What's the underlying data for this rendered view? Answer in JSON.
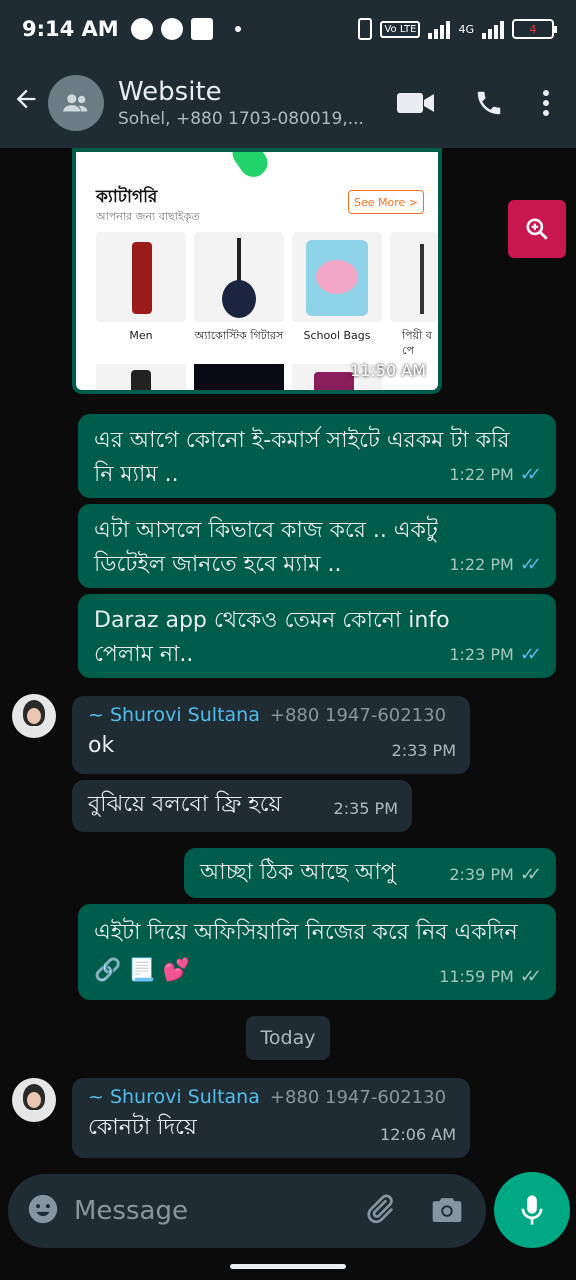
{
  "status_bar": {
    "time": "9:14 AM",
    "vo_lte": "Vo LTE",
    "network": "4G",
    "battery": "4"
  },
  "header": {
    "title": "Website",
    "subtitle": "Sohel, +880 1703-080019,...",
    "icons": [
      "back-arrow-icon",
      "group-avatar-icon",
      "video-call-icon",
      "voice-call-icon",
      "more-options-icon"
    ]
  },
  "image_message": {
    "category_title": "ক্যাটাগরি",
    "category_subtitle": "আপনার জন্য বাছাইকৃত",
    "see_more": "See More >",
    "products": [
      "Men",
      "অ্যাকোস্টিক গিটারস",
      "School Bags",
      "পিয়ী ব পে"
    ],
    "time": "11:50 AM"
  },
  "messages": [
    {
      "dir": "out",
      "text": "এর আগে কোনো ই-কমার্স সাইটে এরকম টা করি নি ম্যাম ..",
      "time": "1:22 PM",
      "read": true
    },
    {
      "dir": "out",
      "text": "এটা আসলে কিভাবে কাজ করে .. একটু ডিটেইল জানতে হবে ম্যাম ..",
      "time": "1:22 PM",
      "read": true
    },
    {
      "dir": "out",
      "text": "Daraz app থেকেও তেমন কোনো info পেলাম না..",
      "time": "1:23 PM",
      "read": true
    },
    {
      "dir": "in",
      "sender": "~ Shurovi Sultana",
      "number": "+880 1947-602130",
      "text": "ok",
      "time": "2:33 PM"
    },
    {
      "dir": "in",
      "text": "বুঝিয়ে বলবো ফ্রি হয়ে",
      "time": "2:35 PM"
    },
    {
      "dir": "out",
      "text": "আচ্ছা ঠিক আছে আপু",
      "time": "2:39 PM",
      "read": false
    },
    {
      "dir": "out",
      "text": "এইটা দিয়ে অফিসিয়ালি নিজের করে নিব একদিন 🔗 📃 💕",
      "time": "11:59 PM",
      "read": false
    },
    {
      "dir": "in",
      "sender": "~ Shurovi Sultana",
      "number": "+880 1947-602130",
      "text": "কোনটা দিয়ে",
      "time": "12:06 AM"
    }
  ],
  "date_divider": "Today",
  "input": {
    "placeholder": "Message"
  },
  "tick_glyph": "✓✓",
  "colors": {
    "outgoing": "#005c4b",
    "incoming": "#1f2c34",
    "accent": "#00a884",
    "read_tick": "#53bdeb",
    "sender_name": "#53bdeb"
  }
}
